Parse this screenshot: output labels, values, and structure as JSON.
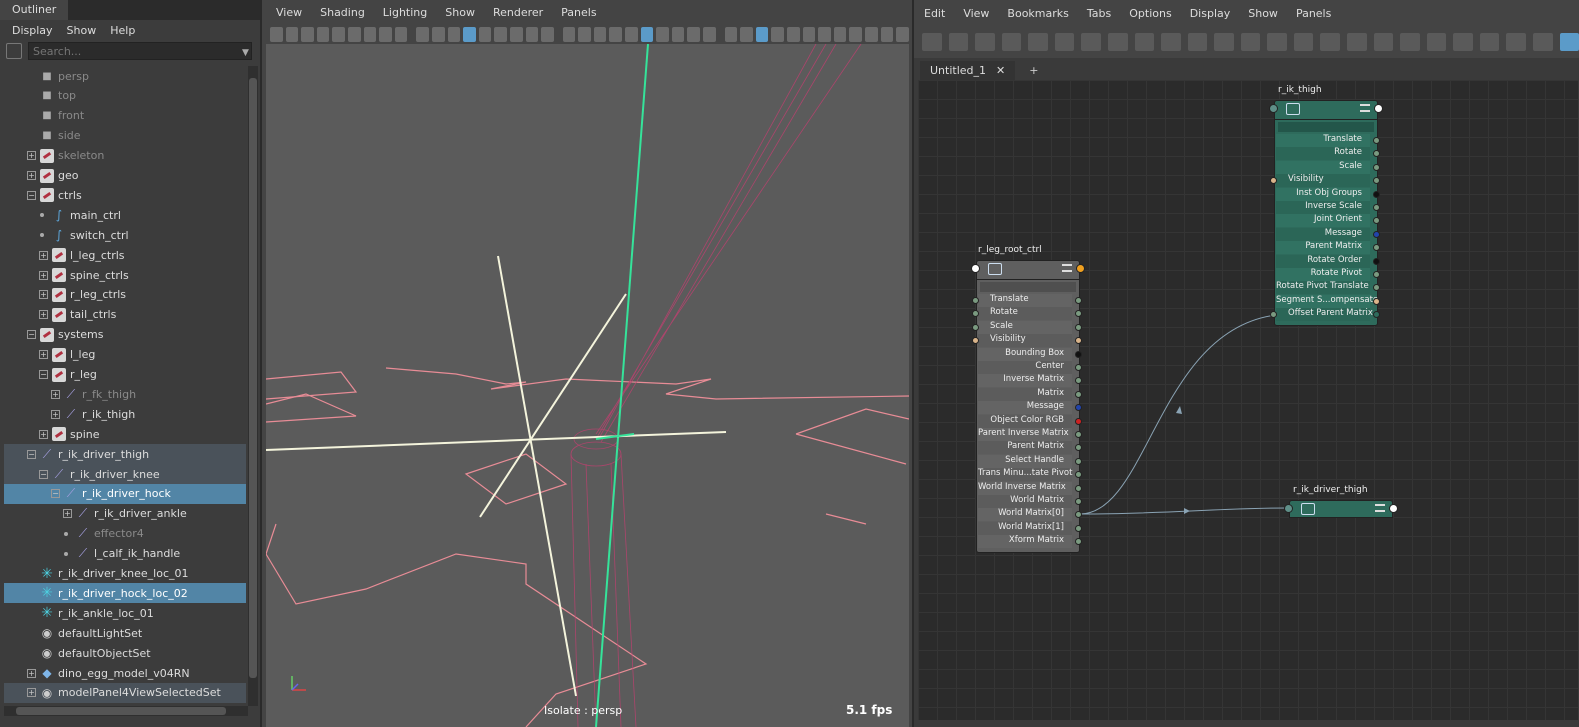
{
  "outliner": {
    "title": "Outliner",
    "menu": [
      "Display",
      "Show",
      "Help"
    ],
    "search_placeholder": "Search...",
    "items": [
      {
        "label": "persp",
        "icon": "camera-icon"
      },
      {
        "label": "top",
        "icon": "camera-icon"
      },
      {
        "label": "front",
        "icon": "camera-icon"
      },
      {
        "label": "side",
        "icon": "camera-icon"
      },
      {
        "label": "skeleton",
        "icon": "group-icon"
      },
      {
        "label": "geo",
        "icon": "group-icon"
      },
      {
        "label": "ctrls",
        "icon": "group-icon"
      },
      {
        "label": "main_ctrl",
        "icon": "curve-icon"
      },
      {
        "label": "switch_ctrl",
        "icon": "curve-icon"
      },
      {
        "label": "l_leg_ctrls",
        "icon": "group-icon"
      },
      {
        "label": "spine_ctrls",
        "icon": "group-icon"
      },
      {
        "label": "r_leg_ctrls",
        "icon": "group-icon"
      },
      {
        "label": "tail_ctrls",
        "icon": "group-icon"
      },
      {
        "label": "systems",
        "icon": "group-icon"
      },
      {
        "label": "l_leg",
        "icon": "group-icon"
      },
      {
        "label": "r_leg",
        "icon": "group-icon"
      },
      {
        "label": "r_fk_thigh",
        "icon": "joint-icon"
      },
      {
        "label": "r_ik_thigh",
        "icon": "joint-icon"
      },
      {
        "label": "spine",
        "icon": "group-icon"
      },
      {
        "label": "r_ik_driver_thigh",
        "icon": "joint-icon"
      },
      {
        "label": "r_ik_driver_knee",
        "icon": "joint-icon"
      },
      {
        "label": "r_ik_driver_hock",
        "icon": "joint-icon"
      },
      {
        "label": "r_ik_driver_ankle",
        "icon": "joint-icon"
      },
      {
        "label": "effector4",
        "icon": "effector-icon"
      },
      {
        "label": "l_calf_ik_handle",
        "icon": "ik-handle-icon"
      },
      {
        "label": "r_ik_driver_knee_loc_01",
        "icon": "locator-icon"
      },
      {
        "label": "r_ik_driver_hock_loc_02",
        "icon": "locator-icon"
      },
      {
        "label": "r_ik_ankle_loc_01",
        "icon": "locator-icon"
      },
      {
        "label": "defaultLightSet",
        "icon": "set-icon"
      },
      {
        "label": "defaultObjectSet",
        "icon": "set-icon"
      },
      {
        "label": "dino_egg_model_v04RN",
        "icon": "reference-icon"
      },
      {
        "label": "modelPanel4ViewSelectedSet",
        "icon": "set-icon"
      }
    ]
  },
  "viewport": {
    "menu": [
      "View",
      "Shading",
      "Lighting",
      "Show",
      "Renderer",
      "Panels"
    ],
    "isolate_label": "Isolate : persp",
    "fps": "5.1 fps"
  },
  "node_editor": {
    "menu": [
      "Edit",
      "View",
      "Bookmarks",
      "Tabs",
      "Options",
      "Display",
      "Show",
      "Panels"
    ],
    "tab_label": "Untitled_1",
    "tab_close": "✕",
    "tab_add": "+",
    "nodes": {
      "r_ik_thigh": {
        "title": "r_ik_thigh",
        "attrs": [
          "Translate",
          "Rotate",
          "Scale",
          "Visibility",
          "Inst Obj Groups",
          "Inverse Scale",
          "Joint Orient",
          "Message",
          "Parent Matrix",
          "Rotate Order",
          "Rotate Pivot",
          "Rotate Pivot Translate",
          "Segment S...ompensate",
          "Offset Parent Matrix"
        ]
      },
      "r_leg_root_ctrl": {
        "title": "r_leg_root_ctrl",
        "attrs": [
          "Translate",
          "Rotate",
          "Scale",
          "Visibility",
          "Bounding Box",
          "Center",
          "Inverse Matrix",
          "Matrix",
          "Message",
          "Object Color RGB",
          "Parent Inverse Matrix",
          "Parent Matrix",
          "Select Handle",
          "Trans Minu...tate Pivot",
          "World Inverse Matrix",
          "World Matrix",
          "World Matrix[0]",
          "World Matrix[1]",
          "Xform Matrix"
        ]
      },
      "r_ik_driver_thigh": {
        "title": "r_ik_driver_thigh"
      }
    },
    "colors": {
      "joint_node": "#2e6b5c",
      "transform_node": "#5f5f5f",
      "connection": "#8aa3b4"
    }
  }
}
